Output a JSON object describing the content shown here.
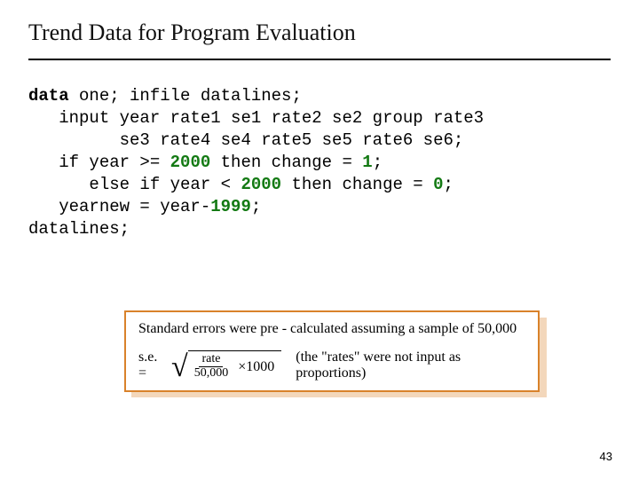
{
  "title": "Trend Data for Program Evaluation",
  "code": {
    "l1a": "data",
    "l1b": " one; infile datalines;",
    "l2": "   input year rate1 se1 rate2 se2 group rate3",
    "l3": "         se3 rate4 se4 rate5 se5 rate6 se6;",
    "l4a": "   if year >= ",
    "l4n": "2000",
    "l4b": " then change = ",
    "l4n2": "1",
    "l4c": ";",
    "l5a": "      else if year < ",
    "l5n": "2000",
    "l5b": " then change = ",
    "l5n2": "0",
    "l5c": ";",
    "l6a": "   yearnew = year-",
    "l6n": "1999",
    "l6b": ";",
    "l7": "datalines;"
  },
  "note": {
    "top": "Standard errors were pre - calculated assuming a sample of 50,000",
    "se_label": "s.e. =",
    "frac_top": "rate",
    "frac_bot": "50,000",
    "mult": "×1000",
    "paren": "(the \"rates\" were not input as proportions)"
  },
  "page": "43"
}
